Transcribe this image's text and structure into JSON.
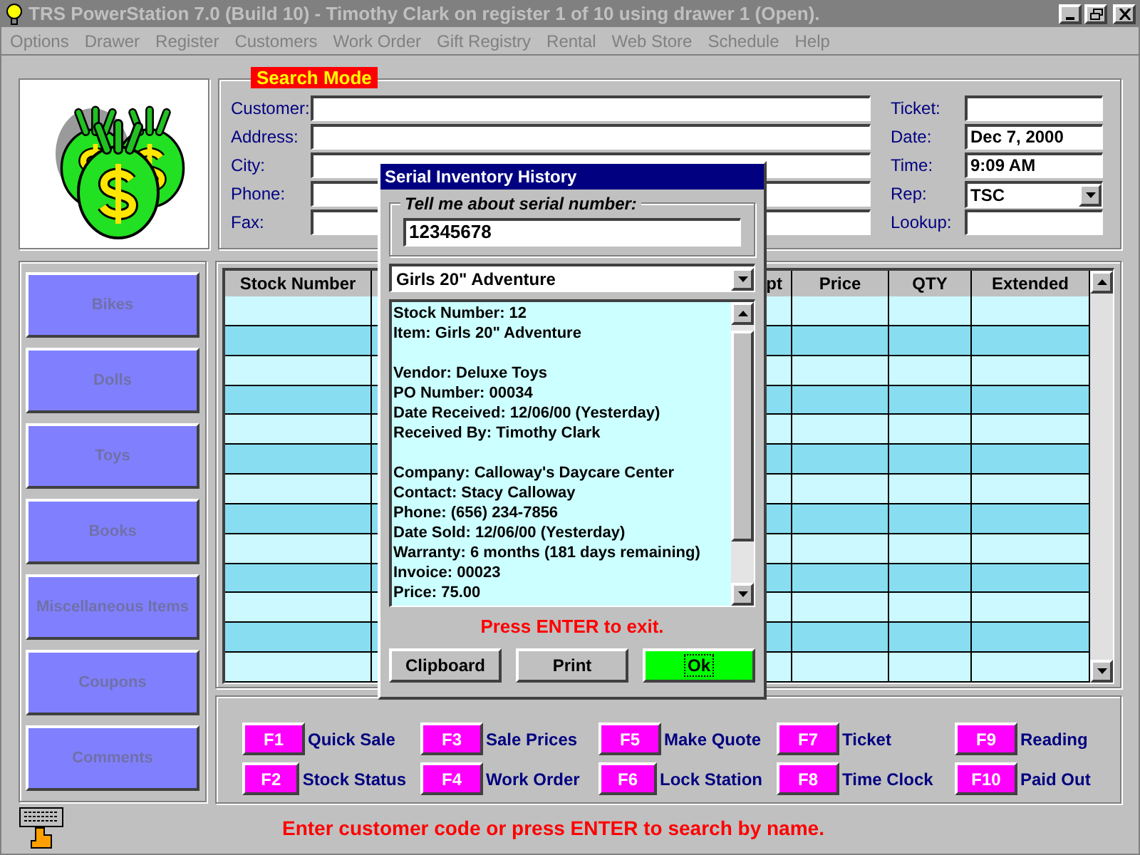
{
  "window": {
    "title": "TRS PowerStation 7.0 (Build 10) - Timothy Clark on register 1 of 10 using drawer 1 (Open)."
  },
  "menu": [
    {
      "label": "Options"
    },
    {
      "label": "Drawer"
    },
    {
      "label": "Register"
    },
    {
      "label": "Customers"
    },
    {
      "label": "Work Order"
    },
    {
      "label": "Gift Registry"
    },
    {
      "label": "Rental"
    },
    {
      "label": "Web Store"
    },
    {
      "label": "Schedule"
    },
    {
      "label": "Help"
    }
  ],
  "mode_label": "Search Mode",
  "customer_fields": [
    {
      "label": "Customer:"
    },
    {
      "label": "Address:"
    },
    {
      "label": "City:"
    },
    {
      "label": "Phone:"
    },
    {
      "label": "Fax:"
    }
  ],
  "ticket_fields": [
    {
      "label": "Ticket:",
      "kind": "text"
    },
    {
      "label": "Date:",
      "kind": "text",
      "value": "Dec 7, 2000"
    },
    {
      "label": "Time:",
      "kind": "text",
      "value": "9:09 AM"
    },
    {
      "label": "Rep:",
      "kind": "dropdown",
      "value": "TSC"
    },
    {
      "label": "Lookup:",
      "kind": "text"
    }
  ],
  "categories": [
    {
      "label": "Bikes",
      "disabled": true
    },
    {
      "label": "Dolls",
      "disabled": true
    },
    {
      "label": "Toys",
      "disabled": true
    },
    {
      "label": "Books",
      "disabled": true
    },
    {
      "label": "Miscellaneous Items",
      "disabled": true
    },
    {
      "label": "Coupons",
      "disabled": true
    },
    {
      "label": "Comments",
      "disabled": true
    }
  ],
  "table": {
    "columns": [
      "Stock Number",
      "pt",
      "Price",
      "QTY",
      "Extended"
    ]
  },
  "function_keys": [
    {
      "key": "F1",
      "label": "Quick Sale"
    },
    {
      "key": "F2",
      "label": "Stock Status"
    },
    {
      "key": "F3",
      "label": "Sale Prices"
    },
    {
      "key": "F4",
      "label": "Work Order"
    },
    {
      "key": "F5",
      "label": "Make Quote"
    },
    {
      "key": "F6",
      "label": "Lock Station"
    },
    {
      "key": "F7",
      "label": "Ticket"
    },
    {
      "key": "F8",
      "label": "Time Clock"
    },
    {
      "key": "F9",
      "label": "Reading"
    },
    {
      "key": "F10",
      "label": "Paid Out"
    }
  ],
  "status_message": "Enter customer code or press ENTER to search by name.",
  "dialog": {
    "title": "Serial Inventory History",
    "group_label": "Tell me about serial number:",
    "serial_number": "12345678",
    "item": "Girls 20\" Adventure",
    "details": [
      [
        "Stock Number: 12",
        "Item: Girls 20\" Adventure"
      ],
      [
        "Vendor: Deluxe Toys",
        "PO Number: 00034",
        "Date Received: 12/06/00 (Yesterday)",
        "Received By: Timothy Clark"
      ],
      [
        "Company: Calloway's Daycare Center",
        "Contact: Stacy Calloway",
        "Phone: (656) 234-7856",
        "Date Sold: 12/06/00 (Yesterday)",
        "Warranty: 6 months (181 days remaining)",
        "Invoice: 00023",
        "Price: 75.00"
      ]
    ],
    "message": "Press ENTER to exit.",
    "buttons": [
      {
        "label": "Clipboard",
        "kind": "normal"
      },
      {
        "label": "Print",
        "kind": "normal"
      },
      {
        "label": "Ok",
        "kind": "default"
      }
    ]
  }
}
